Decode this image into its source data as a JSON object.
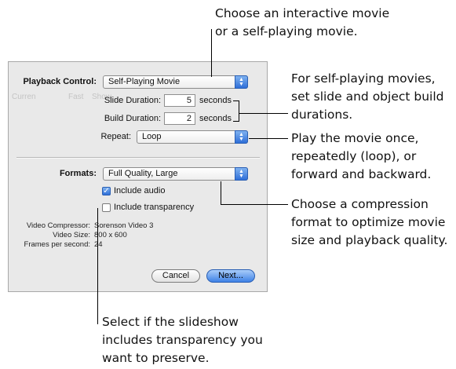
{
  "callouts": {
    "top": [
      "Choose an interactive movie",
      "or a self-playing movie."
    ],
    "durations": [
      "For self-playing movies,",
      "set slide and object build",
      "durations."
    ],
    "repeat": [
      "Play the movie once,",
      "repeatedly (loop), or",
      "forward and backward."
    ],
    "formats": [
      "Choose a compression",
      "format to optimize movie",
      "size and playback quality."
    ],
    "transparency": [
      "Select if the slideshow",
      "includes transparency you",
      "want to preserve."
    ]
  },
  "dialog": {
    "background_text": [
      "Curren",
      "Fast",
      "Show"
    ],
    "playback_control": {
      "label": "Playback Control:",
      "value": "Self-Playing Movie"
    },
    "slide_duration": {
      "label": "Slide Duration:",
      "value": "5",
      "unit": "seconds"
    },
    "build_duration": {
      "label": "Build Duration:",
      "value": "2",
      "unit": "seconds"
    },
    "repeat": {
      "label": "Repeat:",
      "value": "Loop"
    },
    "formats": {
      "label": "Formats:",
      "value": "Full Quality, Large"
    },
    "include_audio": {
      "label": "Include audio",
      "checked": true
    },
    "include_transparency": {
      "label": "Include transparency",
      "checked": false
    },
    "info": {
      "video_compressor_label": "Video Compressor:",
      "video_compressor_value": "Sorenson Video 3",
      "video_size_label": "Video Size:",
      "video_size_value": "800 x 600",
      "fps_label": "Frames per second:",
      "fps_value": "24"
    },
    "buttons": {
      "cancel": "Cancel",
      "next": "Next..."
    }
  },
  "colors": {
    "accent": "#3e82e6",
    "panel": "#e9e9e9"
  }
}
